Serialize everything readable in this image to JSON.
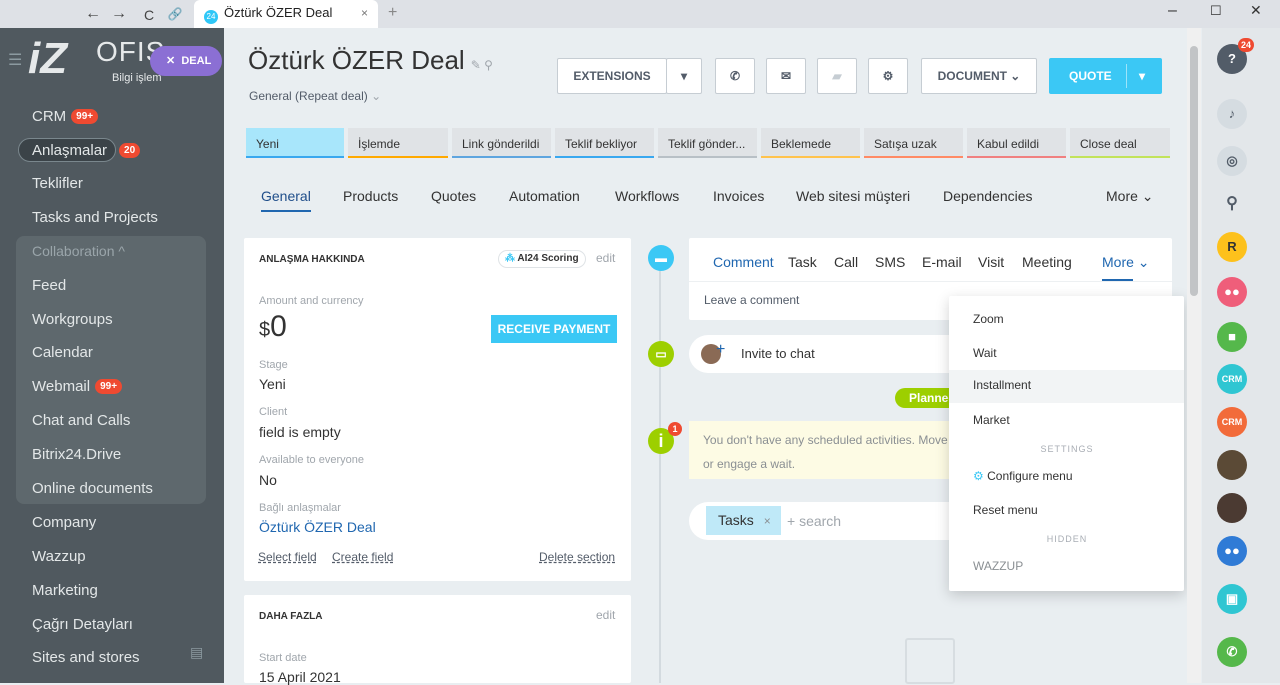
{
  "browser": {
    "tab_title": "Öztürk ÖZER Deal",
    "tab_badge": "24",
    "new_tab": "+",
    "back": "←",
    "forward": "→",
    "reload": "C",
    "link": "🔗",
    "close_tab": "×",
    "min": "–",
    "max": "☐",
    "close": "✕"
  },
  "sidebar": {
    "logo_z": "iZ",
    "logo_ofis": "OFIS",
    "logo_sub": "Bilgi işlem",
    "deal_btn": "DEAL",
    "deal_x": "✕",
    "items": [
      {
        "label": "CRM",
        "badge": "99+"
      },
      {
        "label": "Anlaşmalar",
        "badge": "20"
      },
      {
        "label": "Teklifler"
      },
      {
        "label": "Tasks and Projects"
      },
      {
        "label": "Collaboration ^"
      },
      {
        "label": "Feed"
      },
      {
        "label": "Workgroups"
      },
      {
        "label": "Calendar"
      },
      {
        "label": "Webmail",
        "badge": "99+"
      },
      {
        "label": "Chat and Calls"
      },
      {
        "label": "Bitrix24.Drive"
      },
      {
        "label": "Online documents"
      },
      {
        "label": "Company"
      },
      {
        "label": "Wazzup"
      },
      {
        "label": "Marketing"
      },
      {
        "label": "Çağrı Detayları"
      },
      {
        "label": "Sites and stores"
      }
    ]
  },
  "header": {
    "title": "Öztürk ÖZER  Deal",
    "subtitle": "General (Repeat deal)",
    "extensions": "EXTENSIONS",
    "document": "DOCUMENT",
    "quote": "QUOTE"
  },
  "stages": [
    "Yeni",
    "İşlemde",
    "Link gönderildi",
    "Teklif bekliyor",
    "Teklif gönder...",
    "Beklemede",
    "Satışa uzak",
    "Kabul edildi",
    "Close deal"
  ],
  "tabs": [
    "General",
    "Products",
    "Quotes",
    "Automation",
    "Workflows",
    "Invoices",
    "Web sitesi müşteri",
    "Dependencies",
    "More"
  ],
  "about": {
    "heading": "ANLAŞMA HAKKINDA",
    "scoring": "AI24 Scoring",
    "edit": "edit",
    "amount_label": "Amount and currency",
    "amount_cur": "$",
    "amount": "0",
    "receive": "RECEIVE PAYMENT",
    "stage_label": "Stage",
    "stage": "Yeni",
    "client_label": "Client",
    "client": "field is empty",
    "avail_label": "Available to everyone",
    "avail": "No",
    "bagli_label": "Bağlı anlaşmalar",
    "bagli": "Öztürk ÖZER Deal",
    "select_field": "Select field",
    "create_field": "Create field",
    "delete_section": "Delete section"
  },
  "more_section": {
    "heading": "DAHA FAZLA",
    "edit": "edit",
    "start_label": "Start date",
    "start": "15 April 2021"
  },
  "activity": {
    "tabs": [
      "Comment",
      "Task",
      "Call",
      "SMS",
      "E-mail",
      "Visit",
      "Meeting",
      "More"
    ],
    "placeholder": "Leave a comment",
    "invite": "Invite to chat",
    "planned": "Planned",
    "notice1": "You don't have any scheduled activities. Move",
    "notice2": "or engage a wait.",
    "tasks_chip": "Tasks",
    "search": "+ search",
    "info_badge": "1"
  },
  "dropdown": {
    "items": [
      "Zoom",
      "Wait",
      "Installment",
      "Market"
    ],
    "settings": "SETTINGS",
    "configure": "Configure menu",
    "reset": "Reset menu",
    "hidden": "HIDDEN",
    "wazzup": "WAZZUP"
  },
  "rail": {
    "help_badge": "24",
    "crm": "CRM"
  }
}
